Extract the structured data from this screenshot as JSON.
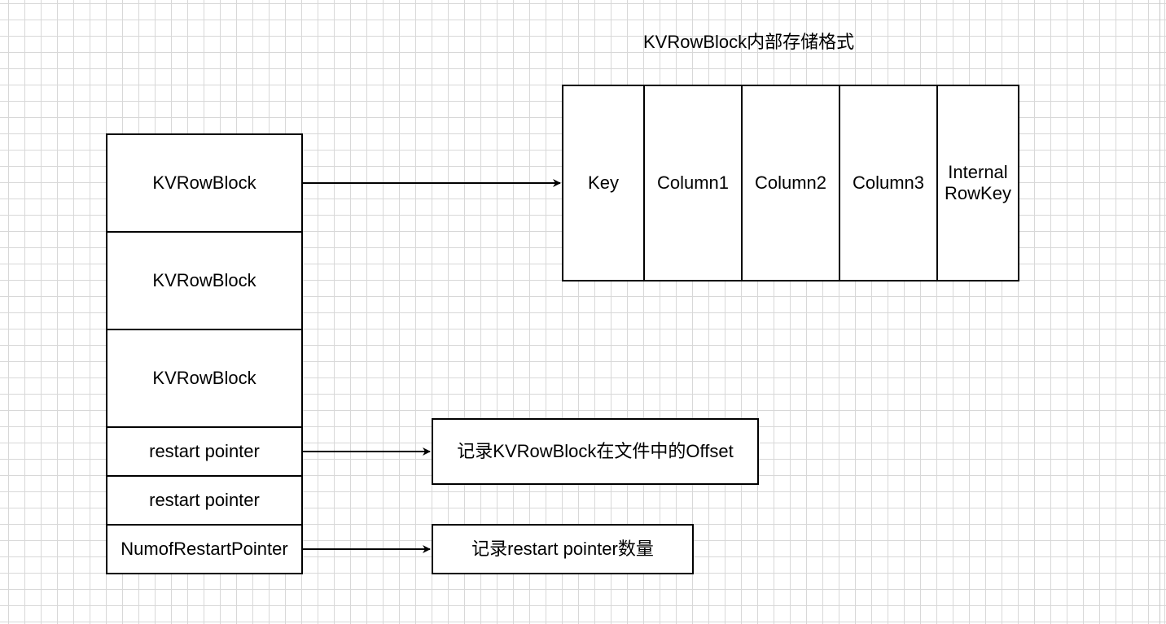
{
  "title": "KVRowBlock内部存储格式",
  "block_stack": [
    "KVRowBlock",
    "KVRowBlock",
    "KVRowBlock",
    "restart pointer",
    "restart pointer",
    "NumofRestartPointer"
  ],
  "row_format": {
    "key": "Key",
    "column1": "Column1",
    "column2": "Column2",
    "column3": "Column3",
    "internal_rowkey_line1": "Internal",
    "internal_rowkey_line2": "RowKey"
  },
  "notes": {
    "offset_note": "记录KVRowBlock在文件中的Offset",
    "count_note": "记录restart pointer数量"
  },
  "colors": {
    "stroke": "#000000",
    "grid": "#d8d8d8",
    "background": "#ffffff"
  }
}
